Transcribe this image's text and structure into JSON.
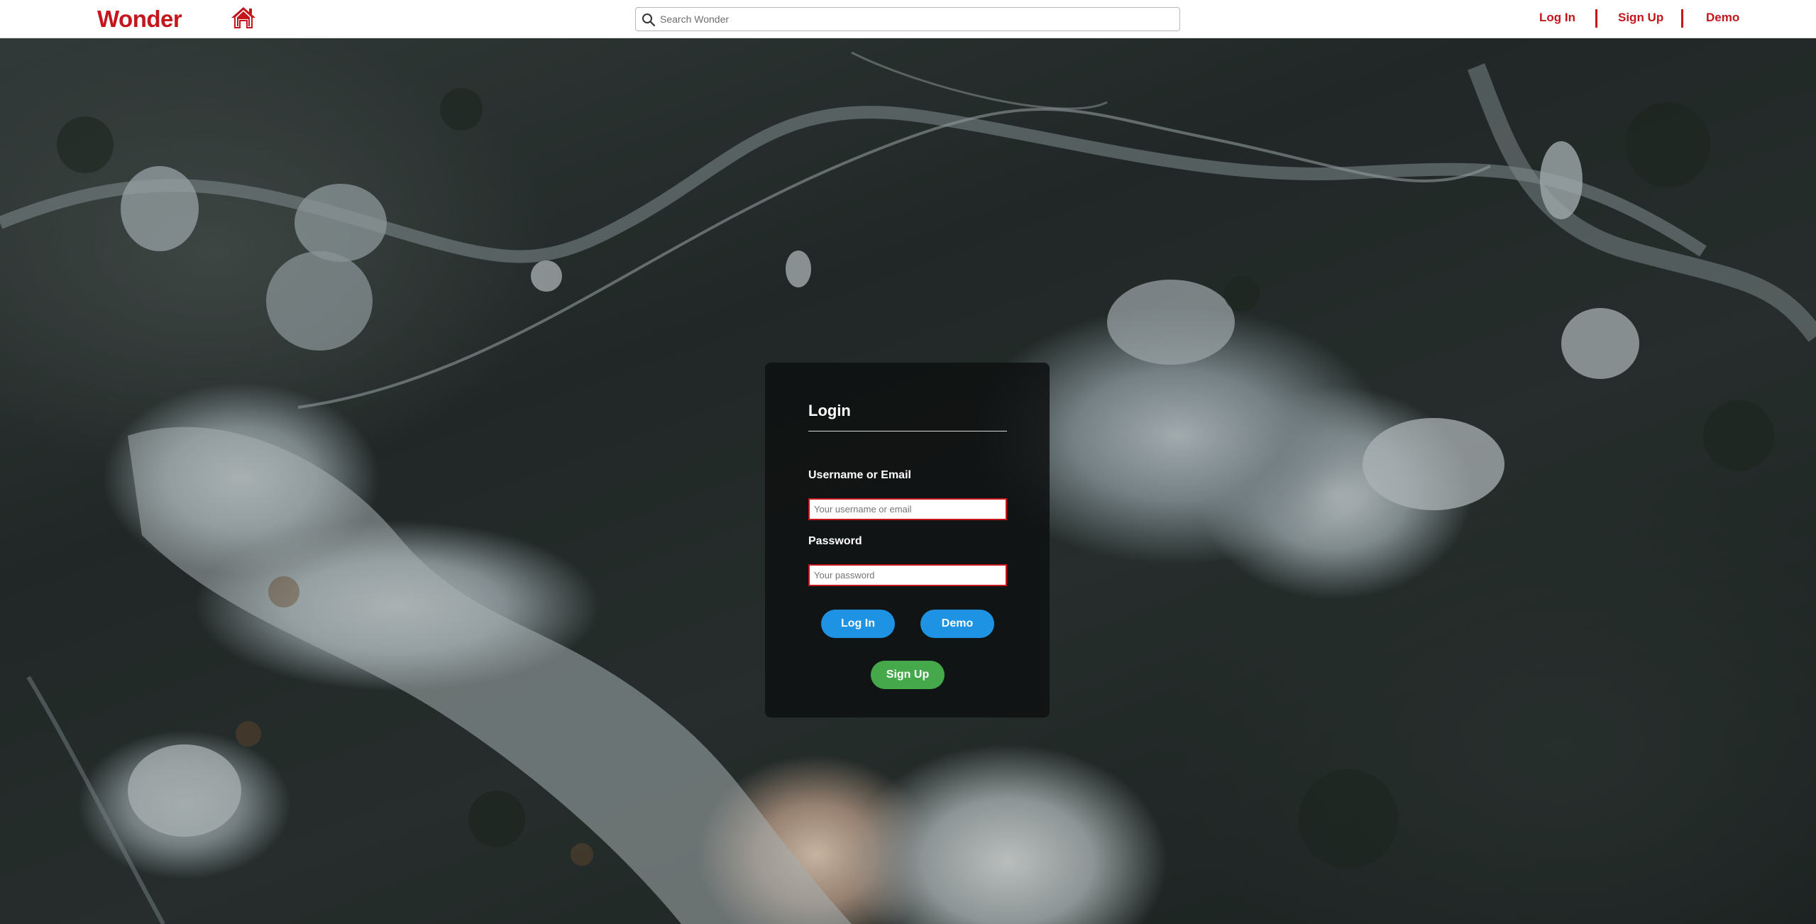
{
  "header": {
    "brand": "Wonder",
    "search_placeholder": "Search Wonder",
    "links": {
      "login": "Log In",
      "signup": "Sign Up",
      "demo": "Demo"
    }
  },
  "login_card": {
    "title": "Login",
    "username_label": "Username or Email",
    "username_placeholder": "Your username or email",
    "password_label": "Password",
    "password_placeholder": "Your password",
    "login_button": "Log In",
    "demo_button": "Demo",
    "signup_button": "Sign Up"
  },
  "colors": {
    "brand_red": "#c4161c",
    "button_blue": "#1f93e3",
    "button_green": "#45a84b"
  },
  "icons": {
    "home": "home-icon",
    "search": "search-icon"
  }
}
